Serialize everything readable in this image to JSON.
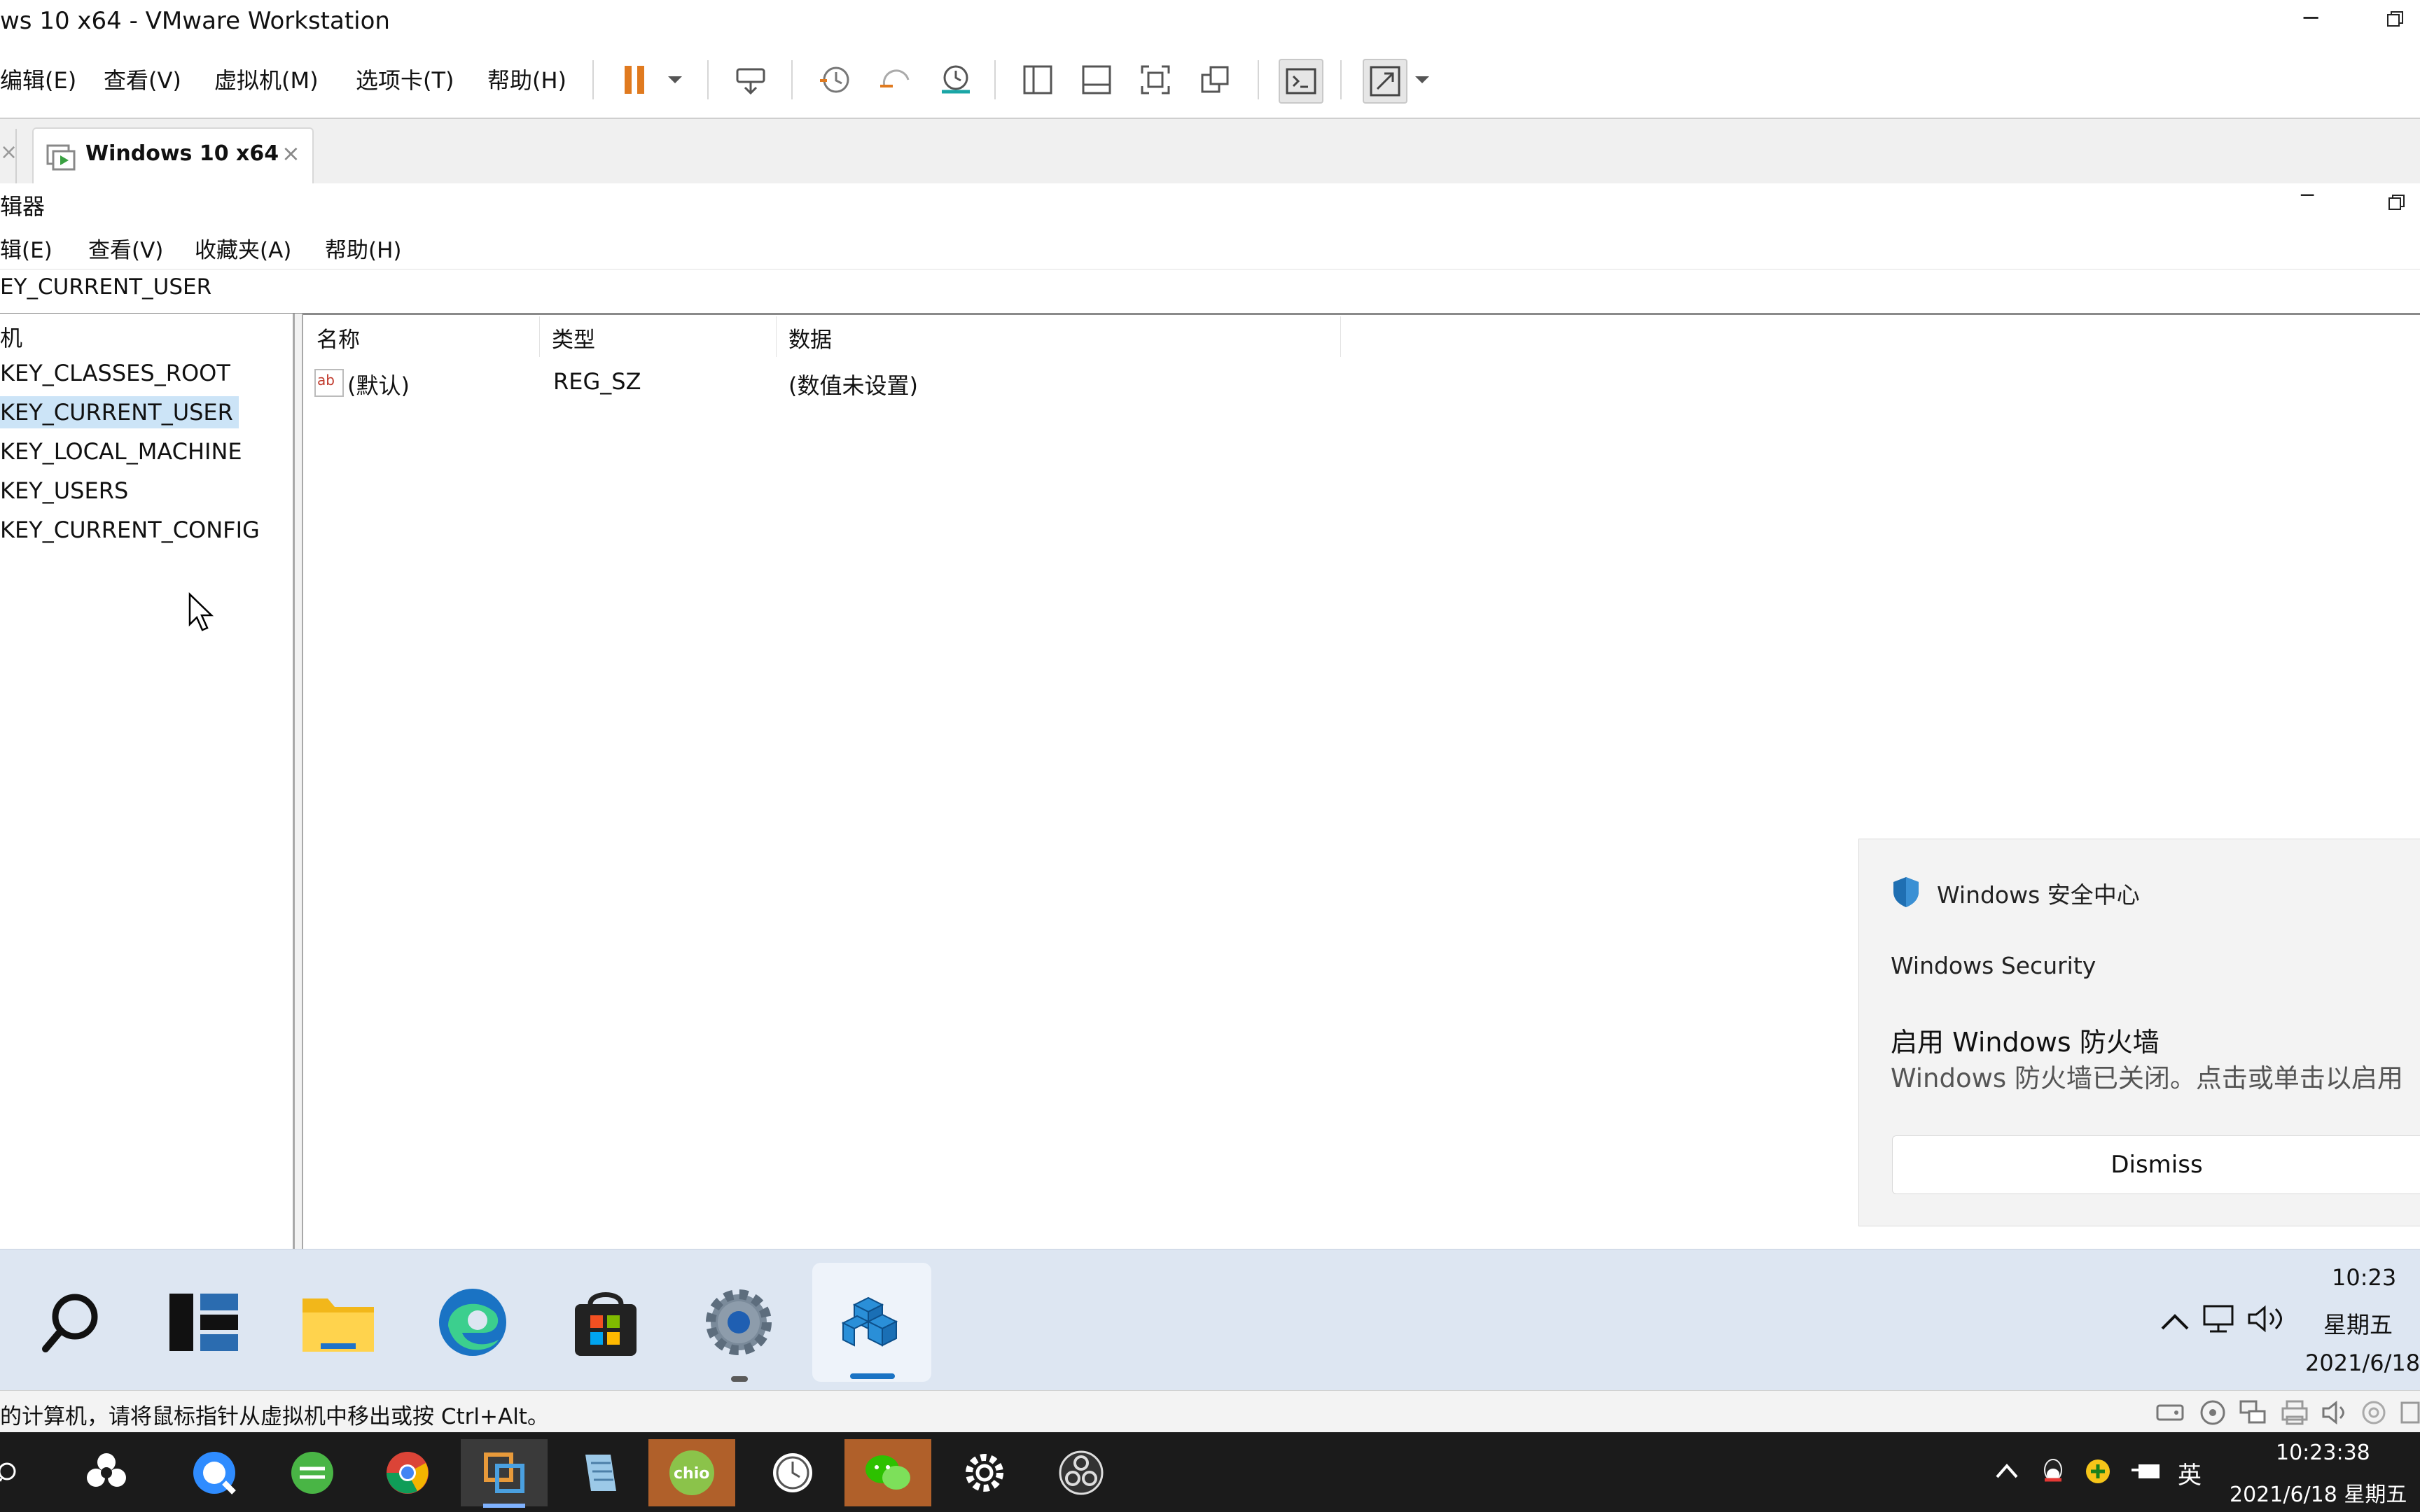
{
  "vmware": {
    "window_title": "ws 10 x64 - VMware Workstation",
    "menu": [
      "编辑(E)",
      "查看(V)",
      "虚拟机(M)",
      "选项卡(T)",
      "帮助(H)"
    ],
    "tab_close_left": "×",
    "tab_label": "Windows 10 x64",
    "tab_close": "×",
    "status_text": "的计算机，请将鼠标指针从虚拟机中移出或按 Ctrl+Alt。",
    "accent": "#e07a1f"
  },
  "regedit": {
    "title": "辑器",
    "menu": [
      "辑(E)",
      "查看(V)",
      "收藏夹(A)",
      "帮助(H)"
    ],
    "address": "EY_CURRENT_USER",
    "tree_root": "机",
    "tree_items": [
      "KEY_CLASSES_ROOT",
      "KEY_CURRENT_USER",
      "KEY_LOCAL_MACHINE",
      "KEY_USERS",
      "KEY_CURRENT_CONFIG"
    ],
    "selected_item": "KEY_CURRENT_USER",
    "columns": [
      "名称",
      "类型",
      "数据"
    ],
    "rows": [
      {
        "name": "(默认)",
        "type": "REG_SZ",
        "data": "(数值未设置)"
      }
    ]
  },
  "toast": {
    "app_name": "Windows 安全中心",
    "subtitle": "Windows Security",
    "heading": "启用 Windows 防火墙",
    "body": "Windows 防火墙已关闭。点击或单击以启用",
    "button": "Dismiss"
  },
  "guest_tray": {
    "up_arrow": "^",
    "time": "10:23",
    "weekday": "星期五",
    "date": "2021/6/18"
  },
  "host_tray": {
    "ime": "英",
    "time": "10:23:38",
    "date": "2021/6/18 星期五"
  }
}
